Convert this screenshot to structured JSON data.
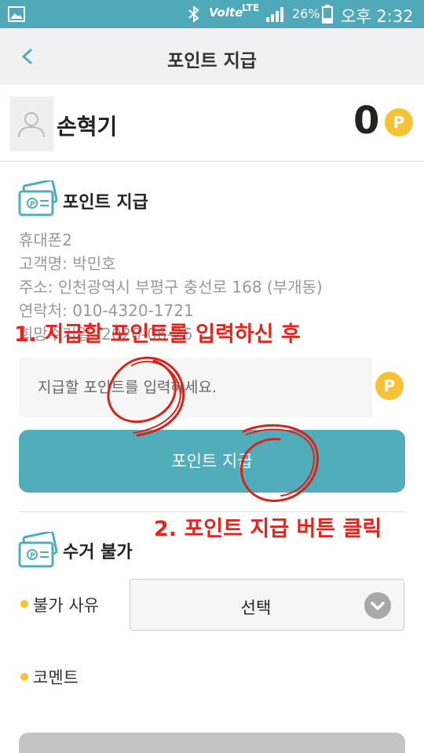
{
  "status_bar": {
    "volte": "Volte",
    "lte": "LTE",
    "battery": "26%",
    "time": "오후 2:32"
  },
  "header": {
    "title": "포인트 지급"
  },
  "user": {
    "name": "손혁기",
    "points": "0",
    "point_badge": "P"
  },
  "payment": {
    "section_title": "포인트 지급",
    "info": [
      "휴대폰2",
      "고객명: 박민호",
      "주소: 인천광역시 부평구 충선로 168 (부개동)",
      "연락처: 010-4320-1721",
      "희망수거일: 2020-06-26"
    ],
    "input_placeholder": "지급할 포인트를 입력하세요.",
    "input_badge": "P",
    "button_label": "포인트 지급"
  },
  "rejection": {
    "section_title": "수거 불가",
    "reason_label": "불가 사유",
    "reason_value": "선택",
    "comment_label": "코멘트"
  },
  "annotations": {
    "step1": "1. 지급할 포인트를 입력하신 후",
    "step2": "2. 포인트 지급 버튼 클릭"
  },
  "colors": {
    "primary": "#52adbb",
    "accent": "#f8c235",
    "annotation": "#e8231b"
  }
}
